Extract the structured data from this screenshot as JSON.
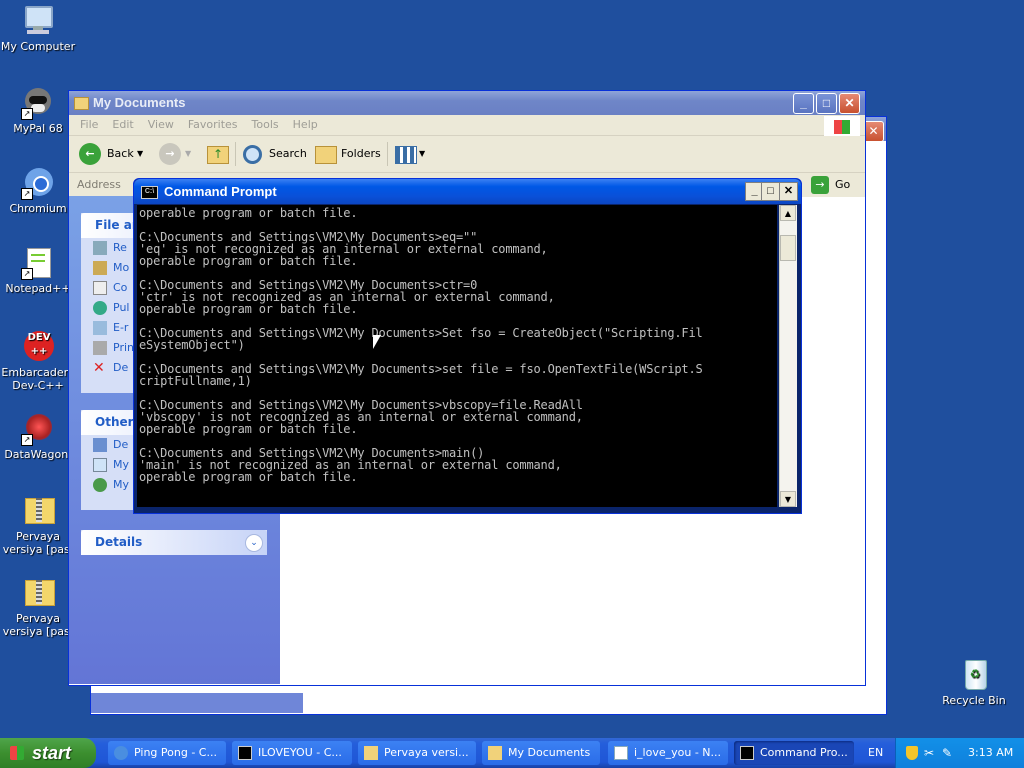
{
  "desktop": {
    "background": "#1f4f9e",
    "icons": [
      {
        "label": "My Computer",
        "icon": "my-computer-icon"
      },
      {
        "label": "MyPal 68",
        "icon": "mypal-icon"
      },
      {
        "label": "Chromium",
        "icon": "chromium-icon"
      },
      {
        "label": "Notepad++",
        "icon": "notepadpp-icon"
      },
      {
        "label": "Embarcadero Dev-C++",
        "icon": "devcpp-icon"
      },
      {
        "label": "DataWagon.",
        "icon": "datawagon-icon"
      },
      {
        "label": "Pervaya versiya [pas.",
        "icon": "zip-folder-icon"
      },
      {
        "label": "Pervaya versiya [pas.",
        "icon": "zip-folder-icon"
      },
      {
        "label": "Recycle Bin",
        "icon": "recycle-bin-icon"
      }
    ]
  },
  "explorer": {
    "title": "My Documents",
    "menu": [
      "File",
      "Edit",
      "View",
      "Favorites",
      "Tools",
      "Help"
    ],
    "toolbar": {
      "back": "Back",
      "search": "Search",
      "folders": "Folders"
    },
    "address_label": "Address",
    "go_label": "Go",
    "task_pane": {
      "file_header": "File an",
      "file_items": [
        "Re",
        "Mo",
        "Co",
        "Pul",
        "E-r",
        "Prin",
        "De"
      ],
      "other_header": "Other",
      "other_items": [
        "De",
        "My",
        "My"
      ],
      "details_header": "Details"
    }
  },
  "cmd": {
    "title": "Command Prompt",
    "lines": [
      "operable program or batch file.",
      "",
      "C:\\Documents and Settings\\VM2\\My Documents>eq=\"\"",
      "'eq' is not recognized as an internal or external command,",
      "operable program or batch file.",
      "",
      "C:\\Documents and Settings\\VM2\\My Documents>ctr=0",
      "'ctr' is not recognized as an internal or external command,",
      "operable program or batch file.",
      "",
      "C:\\Documents and Settings\\VM2\\My Documents>Set fso = CreateObject(\"Scripting.Fil",
      "eSystemObject\")",
      "",
      "C:\\Documents and Settings\\VM2\\My Documents>set file = fso.OpenTextFile(WScript.S",
      "criptFullname,1)",
      "",
      "C:\\Documents and Settings\\VM2\\My Documents>vbscopy=file.ReadAll",
      "'vbscopy' is not recognized as an internal or external command,",
      "operable program or batch file.",
      "",
      "C:\\Documents and Settings\\VM2\\My Documents>main()",
      "'main' is not recognized as an internal or external command,",
      "operable program or batch file."
    ]
  },
  "taskbar": {
    "start_label": "start",
    "tasks": [
      {
        "label": "Ping Pong - C...",
        "icon": "ie-icon"
      },
      {
        "label": "ILOVEYOU - C...",
        "icon": "cmd-icon"
      },
      {
        "label": "Pervaya versi...",
        "icon": "zip-icon"
      },
      {
        "label": "My Documents",
        "icon": "folder-icon"
      },
      {
        "label": "i_love_you - N...",
        "icon": "notepad-icon"
      },
      {
        "label": "Command Pro...",
        "icon": "cmd-icon",
        "active": true
      }
    ],
    "language": "EN",
    "clock": "3:13 AM"
  }
}
